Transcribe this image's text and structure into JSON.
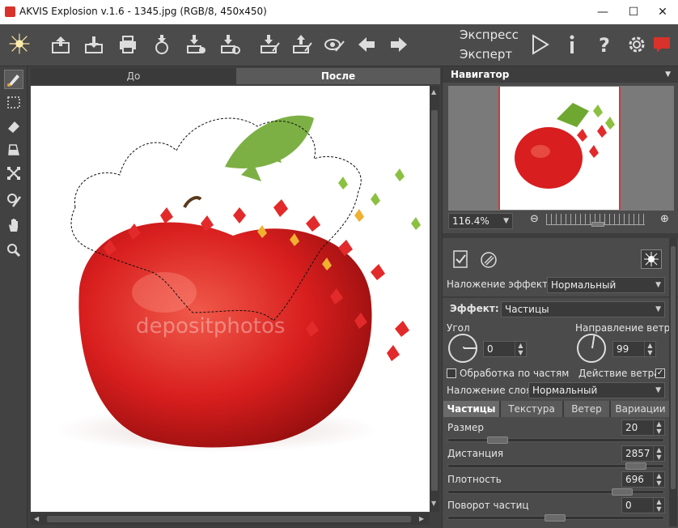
{
  "window": {
    "title": "AKVIS Explosion v.1.6 - 1345.jpg (RGB/8, 450x450)",
    "minimize": "—",
    "maximize": "☐",
    "close": "✕"
  },
  "toolbar": {
    "icons": [
      "explosion-logo-icon",
      "open-icon",
      "save-icon",
      "print-icon",
      "export-icon",
      "batch-icon",
      "settings-batch-icon",
      "load-strokes-icon",
      "save-strokes-icon",
      "show-strokes-icon",
      "undo-icon",
      "redo-icon"
    ],
    "mode_express": "Экспресс",
    "mode_expert": "Эксперт",
    "right_icons": [
      "run-icon",
      "info-icon",
      "help-icon",
      "preferences-icon",
      "news-icon"
    ]
  },
  "left_tools": [
    "explosion-brush-icon",
    "selection-lasso-icon",
    "eraser-icon",
    "fill-icon",
    "transform-icon",
    "sample-brush-icon",
    "hand-icon",
    "zoom-icon"
  ],
  "canvas": {
    "tab_before": "До",
    "tab_after": "После",
    "watermark": "depositphotos"
  },
  "navigator": {
    "title": "Навигатор",
    "zoom": "116.4%"
  },
  "settings": {
    "blend_effect_label": "Наложение эффекта",
    "blend_effect_value": "Нормальный",
    "effect_label": "Эффект:",
    "effect_value": "Частицы",
    "angle_label": "Угол",
    "angle_value": "0",
    "wind_dir_label": "Направление ветра",
    "wind_dir_value": "99",
    "process_parts_label": "Обработка по частям",
    "wind_action_label": "Действие ветра",
    "blend_layer_label": "Наложение слоя",
    "blend_layer_value": "Нормальный",
    "tabs": [
      "Частицы",
      "Текстура",
      "Ветер",
      "Вариации"
    ],
    "params": [
      {
        "label": "Размер",
        "value": "20",
        "level": 0.2
      },
      {
        "label": "Дистанция",
        "value": "2857",
        "level": 0.92
      },
      {
        "label": "Плотность",
        "value": "696",
        "level": 0.85
      },
      {
        "label": "Поворот частиц",
        "value": "0",
        "level": 0.5
      }
    ]
  },
  "colors": {
    "accent_red": "#d8322a",
    "panel": "#4b4b4b",
    "dark": "#3a3a3a"
  }
}
